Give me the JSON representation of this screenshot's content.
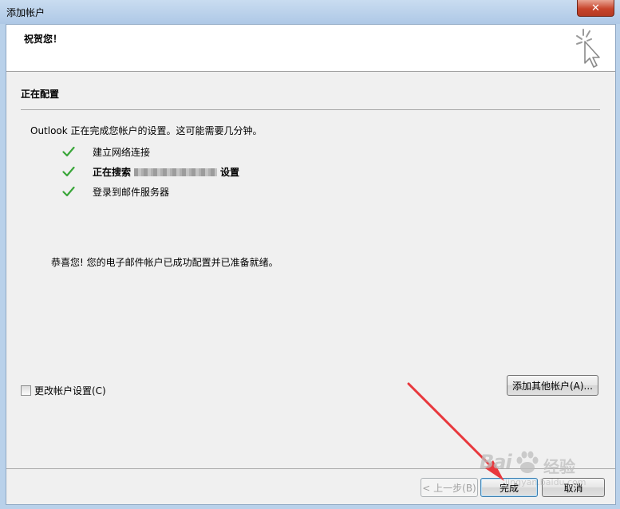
{
  "window": {
    "title": "添加帐户",
    "close_icon": "close-icon",
    "close_glyph": "✕"
  },
  "header": {
    "title": "祝贺您！",
    "icon": "wizard-cursor-icon"
  },
  "section": {
    "title": "正在配置"
  },
  "intro": "Outlook 正在完成您帐户的设置。这可能需要几分钟。",
  "steps": [
    {
      "label": "建立网络连接",
      "icon": "checkmark-icon",
      "bold": false
    },
    {
      "label_prefix": "正在搜索",
      "label_suffix": "设置",
      "icon": "checkmark-icon",
      "bold": true,
      "redacted": true
    },
    {
      "label": "登录到邮件服务器",
      "icon": "checkmark-icon",
      "bold": false
    }
  ],
  "congrats": "恭喜您! 您的电子邮件帐户已成功配置并已准备就绪。",
  "change_settings": {
    "label": "更改帐户设置(C)",
    "checked": false
  },
  "buttons": {
    "add_other": "添加其他帐户(A)...",
    "back": "< 上一步(B)",
    "finish": "完成",
    "cancel": "取消"
  },
  "annotation": {
    "icon": "red-arrow-icon",
    "color": "#e8383d"
  },
  "watermark": {
    "logo": "Bai",
    "cn": "经验",
    "url": "jingyan.baidu.com",
    "icon": "baidu-paw-icon"
  },
  "colors": {
    "check": "#3aa63a",
    "titlebar": "#b9d1ea",
    "close": "#c7452c"
  }
}
